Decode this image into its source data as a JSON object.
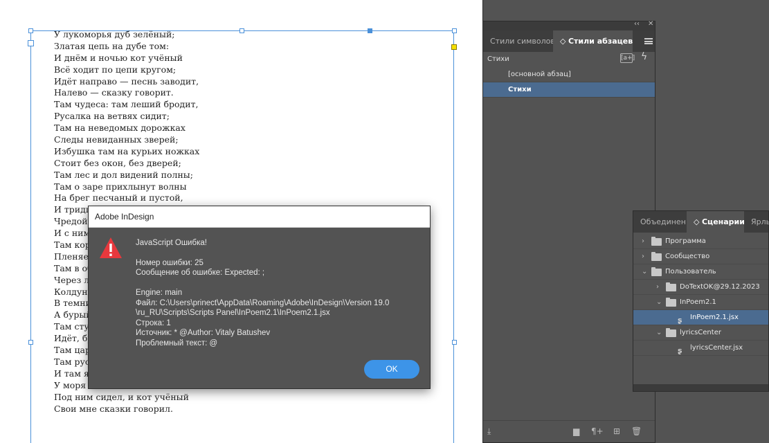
{
  "poem": [
    "У лукоморья дуб зелёный;",
    "Златая цепь на дубе том:",
    "И днём и ночью кот учёный",
    "Всё ходит по цепи кругом;",
    "Идёт направо — песнь заводит,",
    "Налево — сказку говорит.",
    "Там чудеса: там леший бродит,",
    "Русалка на ветвях сидит;",
    "Там на неведомых дорожках",
    "Следы невиданных зверей;",
    "Избушка там на курьих ножках",
    "Стоит без окон, без дверей;",
    "Там лес и дол видений полны;",
    "Там о заре прихлынут волны",
    "На брег песчаный и пустой,",
    "И тридц",
    "Чредой",
    "И с ним",
    "Там кор",
    "Пленяет",
    "Там в об",
    "Через ле",
    "Колдун",
    "В темни",
    "А бурый",
    "Там сту",
    "Идёт, бр",
    "Там цар",
    "Там рус",
    "И там я",
    "У моря в",
    "Под ним сидел, и кот учёный",
    "Свои мне сказки говорил."
  ],
  "paragraph_styles_panel": {
    "tabs": [
      "Стили символов",
      "Стили абзацев"
    ],
    "header": "Стихи",
    "new_style_label": "[a+]",
    "items": [
      "[основной абзац]",
      "Стихи"
    ],
    "selected_index": 1
  },
  "scripts_panel": {
    "tabs": [
      "Объединен",
      "Сценарии",
      "Ярль"
    ],
    "tree": [
      {
        "label": "Программа",
        "level": 0,
        "type": "folder",
        "expanded": false
      },
      {
        "label": "Сообщество",
        "level": 0,
        "type": "folder",
        "expanded": false
      },
      {
        "label": "Пользователь",
        "level": 0,
        "type": "folder",
        "expanded": true
      },
      {
        "label": "DoTextOK@29.12.2023",
        "level": 1,
        "type": "folder",
        "expanded": false
      },
      {
        "label": "InPoem2.1",
        "level": 1,
        "type": "folder",
        "expanded": true
      },
      {
        "label": "InPoem2.1.jsx",
        "level": 2,
        "type": "script",
        "selected": true
      },
      {
        "label": "lyricsCenter",
        "level": 1,
        "type": "folder",
        "expanded": true
      },
      {
        "label": "lyricsCenter.jsx",
        "level": 2,
        "type": "script"
      }
    ]
  },
  "dialog": {
    "title": "Adobe InDesign",
    "heading": "JavaScript Ошибка!",
    "error_number": "Номер ошибки: 25",
    "error_message": "Сообщение об ошибке: Expected: ;",
    "engine": "Engine: main",
    "file_line1": "Файл: C:\\Users\\prinect\\AppData\\Roaming\\Adobe\\InDesign\\Version 19.0",
    "file_line2": "\\ru_RU\\Scripts\\Scripts Panel\\InPoem2.1\\InPoem2.1.jsx",
    "line": "Строка: 1",
    "source": "Источник: * @Author: Vitaly Batushev",
    "problem_text": "Проблемный текст: @",
    "ok_label": "OK"
  },
  "colors": {
    "selection": "#4b6b90",
    "ok_button": "#3d94e8",
    "frame_border": "#4a90d9",
    "warning": "#e8383d"
  },
  "icons": [
    "panel-menu-icon",
    "new-style-icon",
    "clear-overrides-icon",
    "folder-icon",
    "script-icon",
    "warning-icon",
    "trash-icon"
  ]
}
